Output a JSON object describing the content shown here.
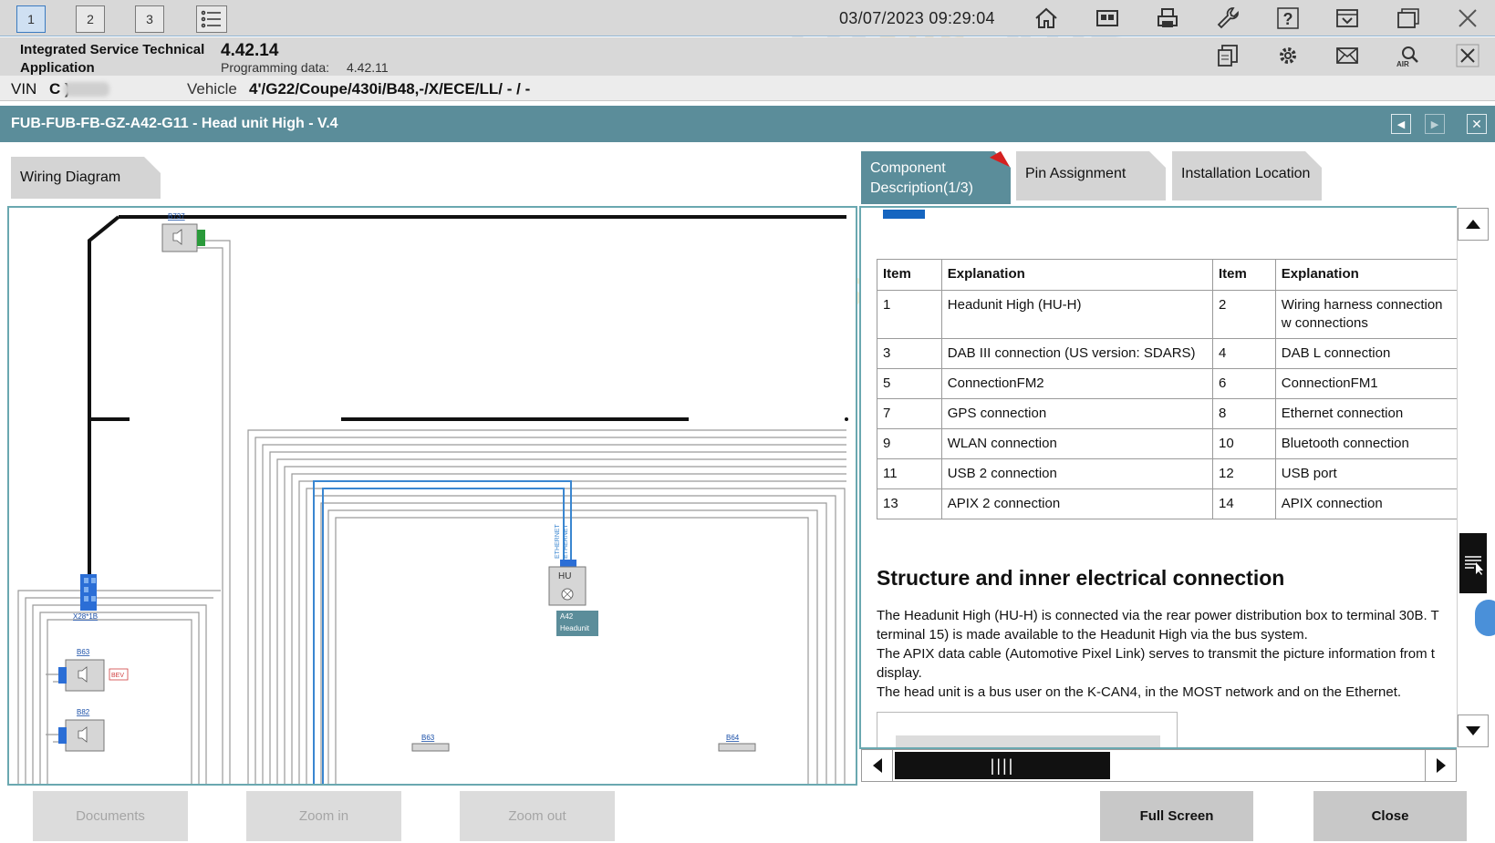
{
  "toolbar": {
    "tabs": [
      "1",
      "2",
      "3"
    ],
    "datetime": "03/07/2023 09:29:04",
    "icons": [
      "home-icon",
      "split-view-icon",
      "print-icon",
      "wrench-icon",
      "help-icon",
      "dropdown-icon",
      "window-icon",
      "close-icon"
    ],
    "icons_row2": [
      "copy-icon",
      "gear-icon",
      "mail-icon",
      "air-search-icon",
      "close-icon"
    ],
    "air_label": "AIR"
  },
  "app": {
    "name": "Integrated Service Technical Application",
    "version": "4.42.14",
    "programming_label": "Programming data:",
    "programming_value": "4.42.11"
  },
  "vehicle": {
    "vin_label": "VIN",
    "vin_value": "C        )",
    "vehicle_label": "Vehicle",
    "vehicle_value": "4'/G22/Coupe/430i/B48,-/X/ECE/LL/ - / -"
  },
  "title": "FUB-FUB-FB-GZ-A42-G11 - Head unit High - V.4",
  "tabs": {
    "wiring": "Wiring Diagram",
    "component": "Component Description(1/3)",
    "pin": "Pin Assignment",
    "installation": "Installation Location"
  },
  "diagram": {
    "labels": {
      "b737": "B737",
      "x28": "X28*1B",
      "b63_left": "B63",
      "b82": "B82",
      "b63_bottom": "B63",
      "b64": "B64",
      "hu": "HU",
      "a42": "A42",
      "headunit": "Headunit",
      "bev": "BEV",
      "ethernet": "ETHERNET"
    }
  },
  "table": {
    "headers": [
      "Item",
      "Explanation",
      "Item",
      "Explanation"
    ],
    "rows": [
      [
        "1",
        "Headunit High (HU-H)",
        "2",
        "Wiring harness connection w connections"
      ],
      [
        "3",
        "DAB III connection (US version: SDARS)",
        "4",
        "DAB L connection"
      ],
      [
        "5",
        "ConnectionFM2",
        "6",
        "ConnectionFM1"
      ],
      [
        "7",
        "GPS connection",
        "8",
        "Ethernet connection"
      ],
      [
        "9",
        "WLAN connection",
        "10",
        "Bluetooth connection"
      ],
      [
        "11",
        "USB 2 connection",
        "12",
        "USB port"
      ],
      [
        "13",
        "APIX 2 connection",
        "14",
        "APIX connection"
      ]
    ]
  },
  "section": {
    "heading": "Structure and inner electrical connection",
    "lines": [
      "The Headunit High (HU-H) is connected via the rear power distribution box to terminal 30B. T",
      "terminal 15) is made available to the Headunit High via the bus system.",
      "The APIX data cable (Automotive Pixel Link) serves to transmit the picture information from t",
      "display.",
      "The head unit is a bus user on the K-CAN4, in the MOST network and on the Ethernet."
    ]
  },
  "buttons": {
    "documents": "Documents",
    "zoom_in": "Zoom in",
    "zoom_out": "Zoom out",
    "full_screen": "Full Screen",
    "close": "Close"
  },
  "watermark": {
    "main": "AUTO",
    "sub": "SVS"
  },
  "colors": {
    "titlebar": "#5b8d9a",
    "active_tab": "#5b8d9a",
    "panel_border": "#6aa8b0",
    "accent_blue": "#1565c0",
    "wire_blue": "#3a86d0"
  }
}
